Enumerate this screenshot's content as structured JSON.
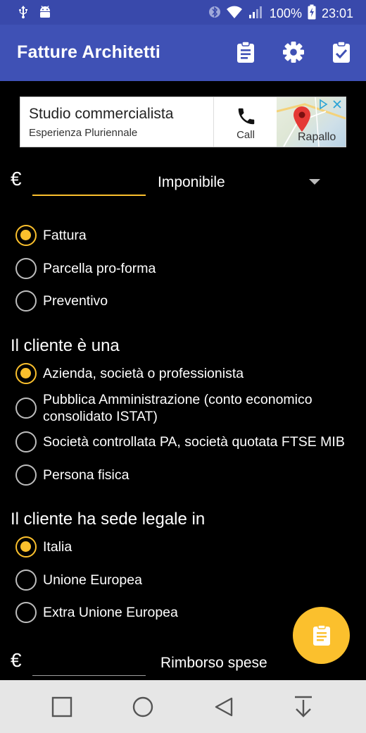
{
  "status_bar": {
    "battery": "100%",
    "time": "23:01",
    "icons": [
      "usb-icon",
      "android-icon",
      "bluetooth-icon",
      "wifi-icon",
      "signal-icon",
      "battery-icon"
    ]
  },
  "app_bar": {
    "title": "Fatture Architetti",
    "actions": [
      "clipboard-icon",
      "gear-icon",
      "clipboard-check-icon"
    ]
  },
  "ad": {
    "title": "Studio commercialista",
    "subtitle": "Esperienza Pluriennale",
    "call_label": "Call",
    "map_label": "Rapallo"
  },
  "amount": {
    "currency": "€",
    "value": "",
    "select_value": "Imponibile"
  },
  "document_type": {
    "options": [
      {
        "label": "Fattura",
        "checked": true
      },
      {
        "label": "Parcella pro-forma",
        "checked": false
      },
      {
        "label": "Preventivo",
        "checked": false
      }
    ]
  },
  "client_type": {
    "title": "Il cliente è una",
    "options": [
      {
        "label": "Azienda, società o professionista",
        "checked": true
      },
      {
        "label": "Pubblica Amministrazione (conto economico consolidato ISTAT)",
        "checked": false
      },
      {
        "label": "Società controllata PA, società quotata FTSE MIB",
        "checked": false
      },
      {
        "label": "Persona fisica",
        "checked": false
      }
    ]
  },
  "client_location": {
    "title": "Il cliente ha sede legale in",
    "options": [
      {
        "label": "Italia",
        "checked": true
      },
      {
        "label": "Unione Europea",
        "checked": false
      },
      {
        "label": "Extra Unione Europea",
        "checked": false
      }
    ]
  },
  "reimbursement": {
    "currency": "€",
    "value": "",
    "label": "Rimborso spese"
  },
  "colors": {
    "primary": "#3f51b5",
    "status_bar": "#3949ab",
    "accent": "#fbc02d",
    "background": "#000000"
  }
}
